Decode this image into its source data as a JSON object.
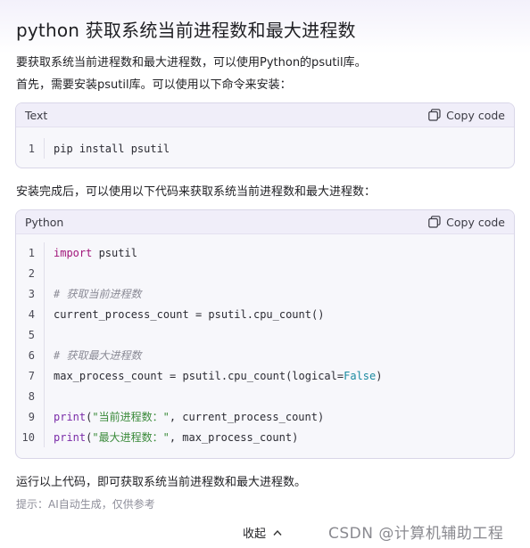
{
  "title": "python 获取系统当前进程数和最大进程数",
  "intro_line1": "要获取系统当前进程数和最大进程数，可以使用Python的psutil库。",
  "intro_line2": "首先，需要安装psutil库。可以使用以下命令来安装：",
  "block1": {
    "language": "Text",
    "copy_label": "Copy code",
    "lines": [
      {
        "num": "1",
        "code": "pip install psutil"
      }
    ]
  },
  "middle_text": "安装完成后，可以使用以下代码来获取系统当前进程数和最大进程数：",
  "block2": {
    "language": "Python",
    "copy_label": "Copy code",
    "line_numbers": [
      "1",
      "2",
      "3",
      "4",
      "5",
      "6",
      "7",
      "8",
      "9",
      "10"
    ],
    "line1_kw": "import",
    "line1_rest": " psutil",
    "line3_comment": "# 获取当前进程数",
    "line4_code": "current_process_count = psutil.cpu_count()",
    "line6_comment": "# 获取最大进程数",
    "line7_pre": "max_process_count = psutil.cpu_count(logical=",
    "line7_const": "False",
    "line7_post": ")",
    "line9_fn": "print",
    "line9_open": "(",
    "line9_str": "\"当前进程数：\"",
    "line9_rest": ", current_process_count)",
    "line10_fn": "print",
    "line10_open": "(",
    "line10_str": "\"最大进程数：\"",
    "line10_rest": ", max_process_count)"
  },
  "outro": "运行以上代码，即可获取系统当前进程数和最大进程数。",
  "hint": "提示：AI自动生成，仅供参考",
  "collapse_label": "收起",
  "watermark": "CSDN @计算机辅助工程",
  "icons": {
    "copy": "copy-icon",
    "collapse": "chevron-up-icon"
  }
}
